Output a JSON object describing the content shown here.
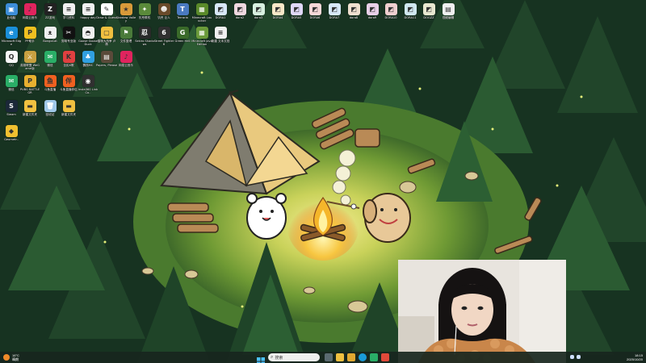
{
  "desktop": {
    "icons": [
      {
        "label": "此电脑",
        "color": "#3d8ed8",
        "glyph": "▣"
      },
      {
        "label": "网易云音乐",
        "color": "#e0245e",
        "glyph": "♪"
      },
      {
        "label": "ZZ游戏",
        "color": "#222222",
        "glyph": "Z"
      },
      {
        "label": "学习资料",
        "color": "#f0f0f0",
        "glyph": "≡"
      },
      {
        "label": "happy day",
        "color": "#f0f0f0",
        "glyph": "≡"
      },
      {
        "label": "Draw & Guess",
        "color": "#ffffff",
        "glyph": "✎"
      },
      {
        "label": "Stardew Valley",
        "color": "#d89a3a",
        "glyph": "★"
      },
      {
        "label": "饥荒联机",
        "color": "#5a8a3a",
        "glyph": "✦"
      },
      {
        "label": "饥荒 巨人",
        "color": "#6a4a2a",
        "glyph": "☻"
      },
      {
        "label": "Terraria",
        "color": "#4a7ac0",
        "glyph": "T"
      },
      {
        "label": "Minecraft Launcher",
        "color": "#5a8a2a",
        "glyph": "▦"
      },
      {
        "label": "DORA1",
        "color": "#d8e8f8",
        "glyph": "◩"
      },
      {
        "label": "dora2",
        "color": "#f0d8e0",
        "glyph": "◩"
      },
      {
        "label": "dora3",
        "color": "#d8f0e0",
        "glyph": "◩"
      },
      {
        "label": "DORA4",
        "color": "#f8e8c8",
        "glyph": "◩"
      },
      {
        "label": "DORA5",
        "color": "#e0d8f8",
        "glyph": "◩"
      },
      {
        "label": "DORA6",
        "color": "#f8d8d8",
        "glyph": "◩"
      },
      {
        "label": "DORA7",
        "color": "#d8e8f8",
        "glyph": "◩"
      },
      {
        "label": "dora8",
        "color": "#f0e0d0",
        "glyph": "◩"
      },
      {
        "label": "dora9",
        "color": "#e8d0e8",
        "glyph": "◩"
      },
      {
        "label": "DORA10",
        "color": "#f0d0d0",
        "glyph": "◩"
      },
      {
        "label": "DORA11",
        "color": "#d0e8f0",
        "glyph": "◩"
      },
      {
        "label": "DOGZZ",
        "color": "#e8e8d0",
        "glyph": "◩"
      },
      {
        "label": "视频编辑",
        "color": "#f0f0f0",
        "glyph": "▤"
      },
      {
        "label": "Microsoft Edge",
        "color": "#1a8fd8",
        "glyph": "e"
      },
      {
        "label": "PP助手",
        "color": "#f0c020",
        "glyph": "P"
      },
      {
        "label": "BongoCat",
        "color": "#f0f0f0",
        "glyph": "ᴥ"
      },
      {
        "label": "剪映专业版",
        "color": "#111111",
        "glyph": "✂"
      },
      {
        "label": "Goose Goose Duck",
        "color": "#f0f0f0",
        "glyph": "◓"
      },
      {
        "label": "猫咪大战争 卢杨",
        "color": "#f0c040",
        "glyph": "▢"
      },
      {
        "label": "文件整理",
        "color": "#4a7a3a",
        "glyph": "⚑"
      },
      {
        "label": "Sekiro Shadows",
        "color": "#2a2a2a",
        "glyph": "忍"
      },
      {
        "label": "Street Fighter 6",
        "color": "#303030",
        "glyph": "6"
      },
      {
        "label": "Green Hell",
        "color": "#3a6a2a",
        "glyph": "G"
      },
      {
        "label": "Minecraft Java Edition",
        "color": "#6a9a3a",
        "glyph": "▦"
      },
      {
        "label": "新建 文本文档",
        "color": "#f0f0f0",
        "glyph": "≡"
      },
      {
        "label": "QQ",
        "color": "#f8f8f8",
        "glyph": "Q"
      },
      {
        "label": "英雄联盟 WeGame版",
        "color": "#c8a040",
        "glyph": "⚔"
      },
      {
        "label": "微信",
        "color": "#2aae67",
        "glyph": "✉"
      },
      {
        "label": "全民K歌",
        "color": "#e04040",
        "glyph": "K"
      },
      {
        "label": "鹦鹉MC",
        "color": "#30a0e0",
        "glyph": "♣"
      },
      {
        "label": "Papers, Please",
        "color": "#5a4a3a",
        "glyph": "▤"
      },
      {
        "label": "网易云音乐",
        "color": "#e0245e",
        "glyph": "♪"
      },
      {
        "label": "微信",
        "color": "#2aae67",
        "glyph": "✉"
      },
      {
        "label": "PUBG BATTLEGR",
        "color": "#e8b030",
        "glyph": "P"
      },
      {
        "label": "斗鱼直播",
        "color": "#f06020",
        "glyph": "鱼"
      },
      {
        "label": "斗鱼直播伴侣",
        "color": "#f06020",
        "glyph": "伴"
      },
      {
        "label": "Insta360 Link Co..",
        "color": "#303030",
        "glyph": "◉"
      },
      {
        "label": "Steam",
        "color": "#1b2838",
        "glyph": "S"
      },
      {
        "label": "新建文件夹",
        "color": "#f0c040",
        "glyph": "▬"
      },
      {
        "label": "回收站",
        "color": "#a0c8e8",
        "glyph": "🗑"
      },
      {
        "label": "新建文件夹",
        "color": "#f0c040",
        "glyph": "▬"
      },
      {
        "label": "Geometr..",
        "color": "#f0c030",
        "glyph": "◆"
      }
    ]
  },
  "taskbar": {
    "search_placeholder": "搜索",
    "weather_temp": "16°C",
    "weather_text": "晴朗",
    "time": "18:15",
    "date": "2025/10/20"
  },
  "colors": {
    "forest_dark": "#173321",
    "forest_mid": "#2a5a30",
    "clearing": "#7ea43a",
    "fire_glow": "#f3e07a",
    "tent": "#e9c97e"
  }
}
